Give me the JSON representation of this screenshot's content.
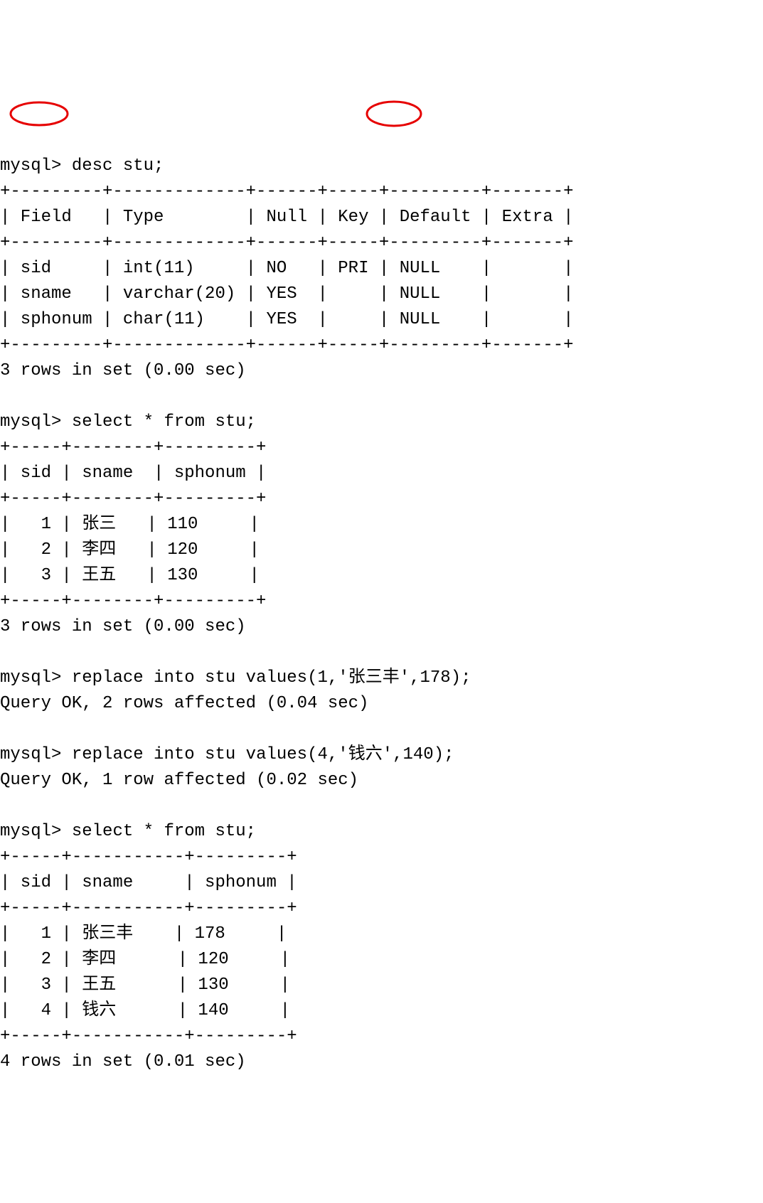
{
  "prompt": "mysql>",
  "cmd1": "desc stu;",
  "sep_desc": "+---------+-------------+------+-----+---------+-------+",
  "header_desc": "| Field   | Type        | Null | Key | Default | Extra |",
  "desc_rows": [
    "| sid     | int(11)     | NO   | PRI | NULL    |       |",
    "| sname   | varchar(20) | YES  |     | NULL    |       |",
    "| sphonum | char(11)    | YES  |     | NULL    |       |"
  ],
  "result1": "3 rows in set (0.00 sec)",
  "cmd2": "select * from stu;",
  "sep_sel1": "+-----+--------+---------+",
  "header_sel1": "| sid | sname  | sphonum |",
  "sel1_rows": [
    "|   1 | 张三   | 110     |",
    "|   2 | 李四   | 120     |",
    "|   3 | 王五   | 130     |"
  ],
  "result2": "3 rows in set (0.00 sec)",
  "cmd3": "replace into stu values(1,'张三丰',178);",
  "result3": "Query OK, 2 rows affected (0.04 sec)",
  "cmd4": "replace into stu values(4,'钱六',140);",
  "result4": "Query OK, 1 row affected (0.02 sec)",
  "cmd5": "select * from stu;",
  "sep_sel2": "+-----+-----------+---------+",
  "header_sel2": "| sid | sname     | sphonum |",
  "sel2_rows": [
    "|   1 | 张三丰    | 178     |",
    "|   2 | 李四      | 120     |",
    "|   3 | 王五      | 130     |",
    "|   4 | 钱六      | 140     |"
  ],
  "result5": "4 rows in set (0.01 sec)",
  "blank": ""
}
